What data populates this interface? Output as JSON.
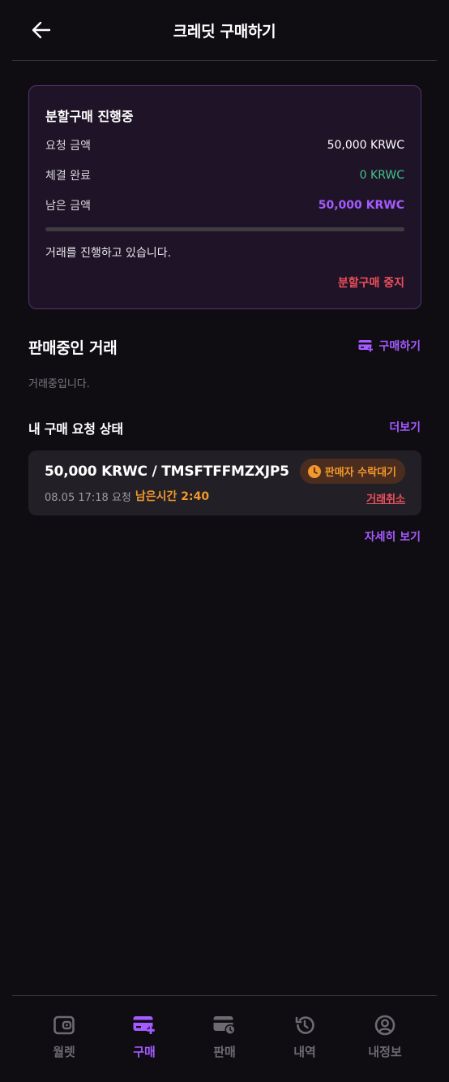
{
  "header": {
    "title": "크레딧 구매하기"
  },
  "split": {
    "title": "분할구매 진행중",
    "requested_label": "요청 금액",
    "requested_value": "50,000 KRWC",
    "completed_label": "체결 완료",
    "completed_value": "0 KRWC",
    "remaining_label": "남은 금액",
    "remaining_value": "50,000 KRWC",
    "progress_percent": 0,
    "status_text": "거래를 진행하고 있습니다.",
    "stop_label": "분할구매 중지"
  },
  "selling": {
    "title": "판매중인 거래",
    "buy_label": "구매하기",
    "empty_text": "거래중입니다."
  },
  "my_requests": {
    "title": "내 구매 요청 상태",
    "more_label": "더보기",
    "item": {
      "summary": "50,000 KRWC / TMSFTFFMZXJP5",
      "time": "08.05 17:18 요청",
      "remaining": "남은시간 2:40",
      "status": "판매자 수락대기",
      "cancel_label": "거래취소"
    },
    "detail_label": "자세히 보기"
  },
  "nav": {
    "items": [
      {
        "label": "월렛",
        "icon": "wallet-icon",
        "active": false
      },
      {
        "label": "구매",
        "icon": "card-plus-icon",
        "active": true
      },
      {
        "label": "판매",
        "icon": "card-clock-icon",
        "active": false
      },
      {
        "label": "내역",
        "icon": "history-icon",
        "active": false
      },
      {
        "label": "내정보",
        "icon": "user-icon",
        "active": false
      }
    ]
  },
  "colors": {
    "accent": "#a45bff",
    "success": "#3fc48e",
    "warning": "#f2972b",
    "danger": "#ef4f5c",
    "background": "#0f0c12"
  }
}
